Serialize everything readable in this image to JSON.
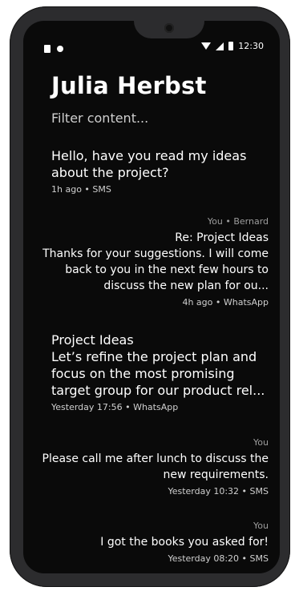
{
  "status_bar": {
    "time": "12:30",
    "icons": [
      "sim-icon",
      "dot-icon",
      "wifi-icon",
      "signal-icon",
      "battery-icon"
    ]
  },
  "header": {
    "title": "Julia Herbst",
    "filter_placeholder": "Filter content..."
  },
  "messages": [
    {
      "direction": "incoming",
      "subject": "",
      "body": "Hello, have you read my ideas about the project?",
      "meta": "1h ago • SMS"
    },
    {
      "direction": "outgoing",
      "sender": "You • Bernard",
      "subject": "Re: Project Ideas",
      "body": "Thanks for your suggestions. I will come back to you in the next few hours to discuss the new plan for ou...",
      "meta": "4h ago • WhatsApp"
    },
    {
      "direction": "incoming",
      "subject": "Project Ideas",
      "body": "Let’s refine the project plan and focus on the most promising target group for our product rel...",
      "meta": "Yesterday 17:56 • WhatsApp"
    },
    {
      "direction": "outgoing",
      "sender": "You",
      "body": "Please call me after lunch to discuss the new requirements.",
      "meta": "Yesterday 10:32 •  SMS"
    },
    {
      "direction": "outgoing",
      "sender": "You",
      "body": "I got the  books you asked for!",
      "meta": "Yesterday 08:20 •  SMS"
    }
  ]
}
